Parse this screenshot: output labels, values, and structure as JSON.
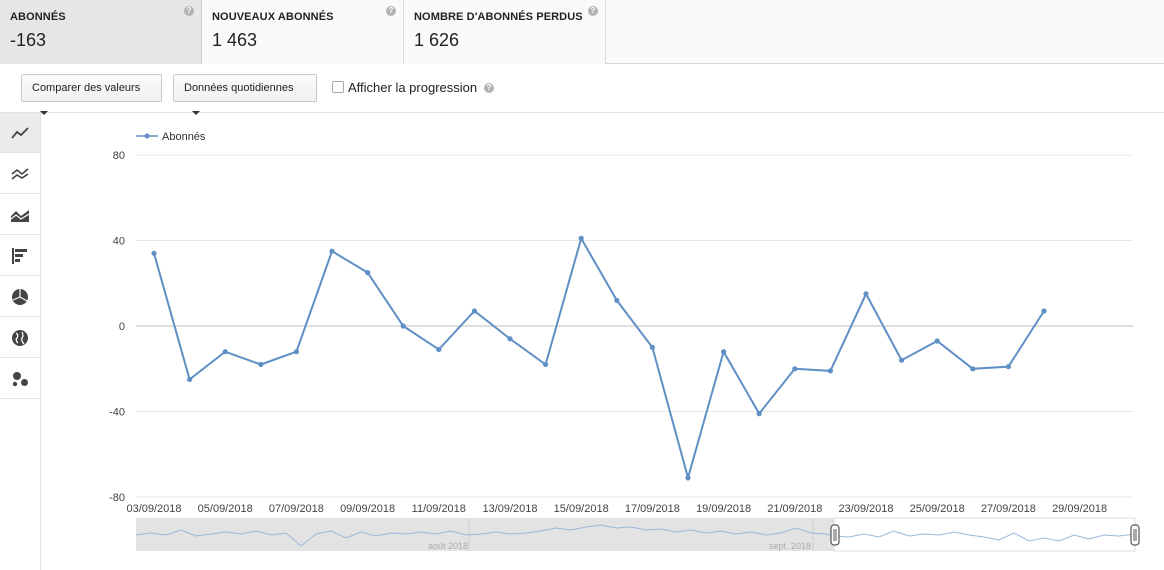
{
  "metrics": [
    {
      "label": "ABONNÉS",
      "value": "-163",
      "help": "?"
    },
    {
      "label": "NOUVEAUX ABONNÉS",
      "value": "1 463",
      "help": "?"
    },
    {
      "label": "NOMBRE D'ABONNÉS PERDUS",
      "value": "1 626",
      "help": "?"
    }
  ],
  "toolbar": {
    "compare_label": "Comparer des valeurs",
    "granularity_label": "Données quotidiennes",
    "progress_label": "Afficher la progression",
    "progress_checked": false,
    "help": "?"
  },
  "sidebar": {
    "icons": [
      "line-chart-icon",
      "multi-line-chart-icon",
      "area-chart-icon",
      "bar-chart-icon",
      "pie-chart-icon",
      "map-icon",
      "bubble-chart-icon"
    ],
    "active": 0
  },
  "colors": {
    "series": "#5f8fc5",
    "grid": "#e8e8e8",
    "zero_line": "#cccccc"
  },
  "chart_data": {
    "type": "line",
    "series": [
      {
        "name": "Abonnés",
        "values": [
          34,
          -25,
          -12,
          -18,
          -12,
          35,
          25,
          0,
          -11,
          7,
          -6,
          -18,
          41,
          12,
          -10,
          -71,
          -12,
          -41,
          -20,
          -21,
          15,
          -16,
          -7,
          -20,
          -19,
          7
        ]
      }
    ],
    "x": [
      "03/09/2018",
      "04/09/2018",
      "05/09/2018",
      "06/09/2018",
      "07/09/2018",
      "08/09/2018",
      "09/09/2018",
      "10/09/2018",
      "11/09/2018",
      "12/09/2018",
      "13/09/2018",
      "14/09/2018",
      "15/09/2018",
      "16/09/2018",
      "17/09/2018",
      "18/09/2018",
      "19/09/2018",
      "20/09/2018",
      "21/09/2018",
      "22/09/2018",
      "23/09/2018",
      "24/09/2018",
      "25/09/2018",
      "26/09/2018",
      "27/09/2018",
      "28/09/2018"
    ],
    "x_tick_labels": [
      "03/09/2018",
      "05/09/2018",
      "07/09/2018",
      "09/09/2018",
      "11/09/2018",
      "13/09/2018",
      "15/09/2018",
      "17/09/2018",
      "19/09/2018",
      "21/09/2018",
      "23/09/2018",
      "25/09/2018",
      "27/09/2018",
      "29/09/2018"
    ],
    "y_ticks": [
      80,
      40,
      0,
      -40,
      -80
    ],
    "ylim": [
      -80,
      80
    ],
    "grid": true,
    "legend": "top-left"
  },
  "navigator": {
    "month_labels": [
      "août 2018",
      "sept. 2018"
    ]
  }
}
